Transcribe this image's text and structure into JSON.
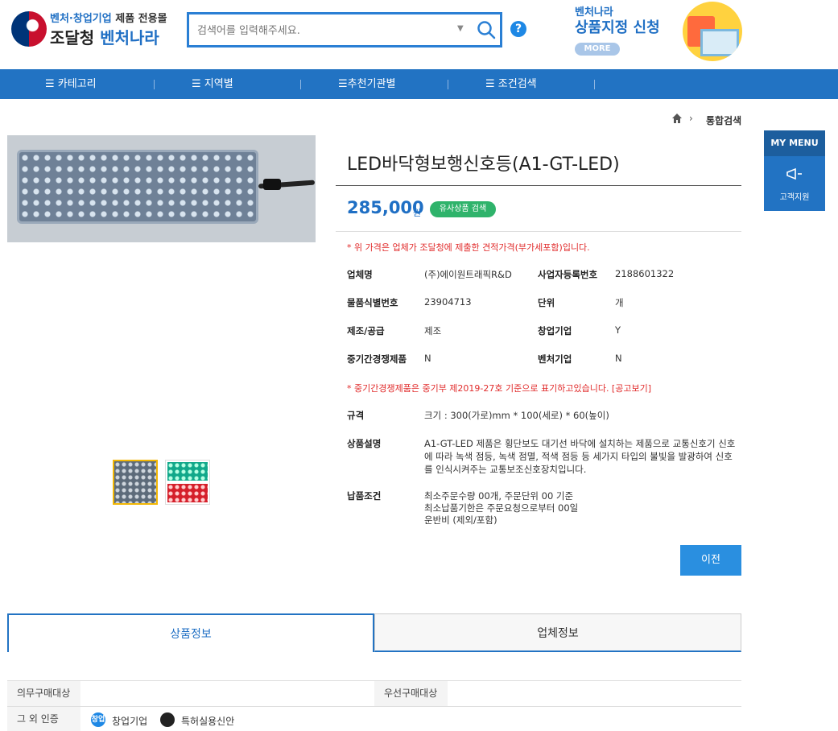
{
  "header": {
    "logo_top_highlight": "벤처·창업기업",
    "logo_top_rest": " 제품 전용몰",
    "logo_bottom_org": "조달청 ",
    "logo_bottom_brand": "벤처나라",
    "search_placeholder": "검색어를 입력해주세요.",
    "help_label": "?",
    "banner_small": "벤처나라",
    "banner_big": "상품지정 신청",
    "banner_more": "MORE"
  },
  "nav": {
    "items": [
      {
        "label": "카테고리",
        "icon": "menu-icon"
      },
      {
        "label": "지역별",
        "icon": "menu-icon"
      },
      {
        "label": "추천기관별",
        "icon": "menu-icon"
      },
      {
        "label": "조건검색",
        "icon": "menu-icon"
      }
    ]
  },
  "breadcrumb": {
    "arrow": "›",
    "current": "통합검색"
  },
  "product": {
    "title": "LED바닥형보행신호등(A1-GT-LED)",
    "price": "285,000",
    "price_unit": "원",
    "similar_button": "유사상품 검색",
    "notice_price": "* 위 가격은 업체가 조달청에 제출한 견적가격(부가세포함)입니다.",
    "notice_sme": "* 중기간경쟁제품은 중기부 제2019-27호 기준으로 표기하고있습니다. [공고보기]",
    "info": {
      "company_label": "업체명",
      "company_value": "(주)에이원트래픽R&D",
      "bizno_label": "사업자등록번호",
      "bizno_value": "2188601322",
      "itemno_label": "물품식별번호",
      "itemno_value": "23904713",
      "unit_label": "단위",
      "unit_value": "개",
      "make_label": "제조/공급",
      "make_value": "제조",
      "startup_label": "창업기업",
      "startup_value": "Y",
      "sme_label": "중기간경쟁제품",
      "sme_value": "N",
      "venture_label": "벤처기업",
      "venture_value": "N"
    },
    "spec_label": "규격",
    "spec_value": "크기 : 300(가로)mm * 100(세로) * 60(높이)",
    "desc_label": "상품설명",
    "desc_value": "A1-GT-LED 제품은 횡단보도 대기선 바닥에 설치하는 제품으로 교통신호기 신호에 따라 녹색 점등, 녹색 점멸, 적색 점등 등 세가지 타입의 불빛을 발광하여 신호를 인식시켜주는 교통보조신호장치입니다.",
    "delivery_label": "납품조건",
    "delivery_lines": [
      "최소주문수량 00개, 주문단위 00 기준",
      "최소납품기한은 주문요청으로부터 00일",
      "운반비 (제외/포함)"
    ],
    "prev_button": "이전"
  },
  "tabs": {
    "product_info": "상품정보",
    "company_info": "업체정보"
  },
  "detail_table": {
    "mandatory_label": "의무구매대상",
    "priority_label": "우선구매대상",
    "other_cert_label": "그 외 인증",
    "certs": [
      {
        "icon_text": "창업",
        "label": "창업기업",
        "color": "#1e88e5"
      },
      {
        "icon_text": "",
        "label": "특허실용신안",
        "color": "#222222"
      }
    ]
  },
  "mymenu": {
    "title": "MY MENU",
    "support_label": "고객지원"
  },
  "colors": {
    "primary": "#2273c3",
    "accent_text": "#1f6fc4",
    "notice_red": "#e12b2b",
    "badge_green": "#2fb36b"
  }
}
